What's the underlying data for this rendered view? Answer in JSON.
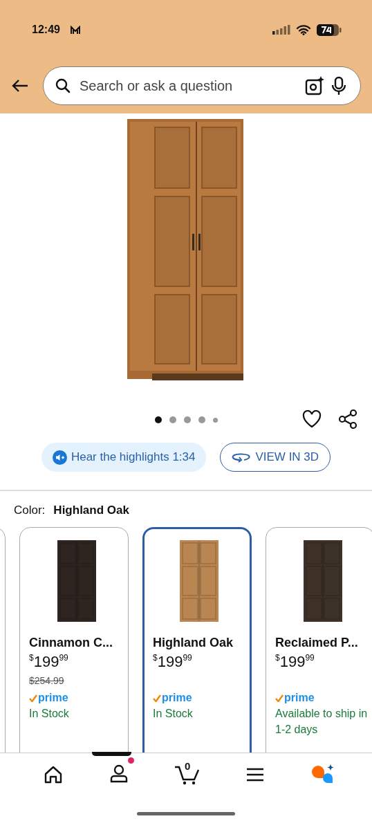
{
  "status_bar": {
    "time": "12:49"
  },
  "search": {
    "placeholder": "Search or ask a question"
  },
  "gallery": {
    "dots": [
      {
        "selected": true
      },
      {
        "selected": false
      },
      {
        "selected": false
      },
      {
        "selected": false
      },
      {
        "selected": false
      }
    ]
  },
  "actions": {
    "hear": "Hear the highlights 1:34",
    "view_3d": "VIEW IN 3D"
  },
  "color": {
    "label": "Color:",
    "value": "Highland Oak"
  },
  "variants": [
    {
      "name": "Cinnamon C...",
      "currency": "$",
      "whole": "199",
      "fraction": "99",
      "list_price": "$254.99",
      "prime": "prime",
      "availability": "In Stock",
      "selected": false,
      "color": "#2e2520"
    },
    {
      "name": "Highland Oak",
      "currency": "$",
      "whole": "199",
      "fraction": "99",
      "prime": "prime",
      "availability": "In Stock",
      "selected": true,
      "color": "#b98550"
    },
    {
      "name": "Reclaimed P...",
      "currency": "$",
      "whole": "199",
      "fraction": "99",
      "prime": "prime",
      "availability": "Available to ship in 1-2 days",
      "selected": false,
      "color": "#3e3228"
    }
  ],
  "bottom_nav": {
    "cart_count": "0"
  }
}
